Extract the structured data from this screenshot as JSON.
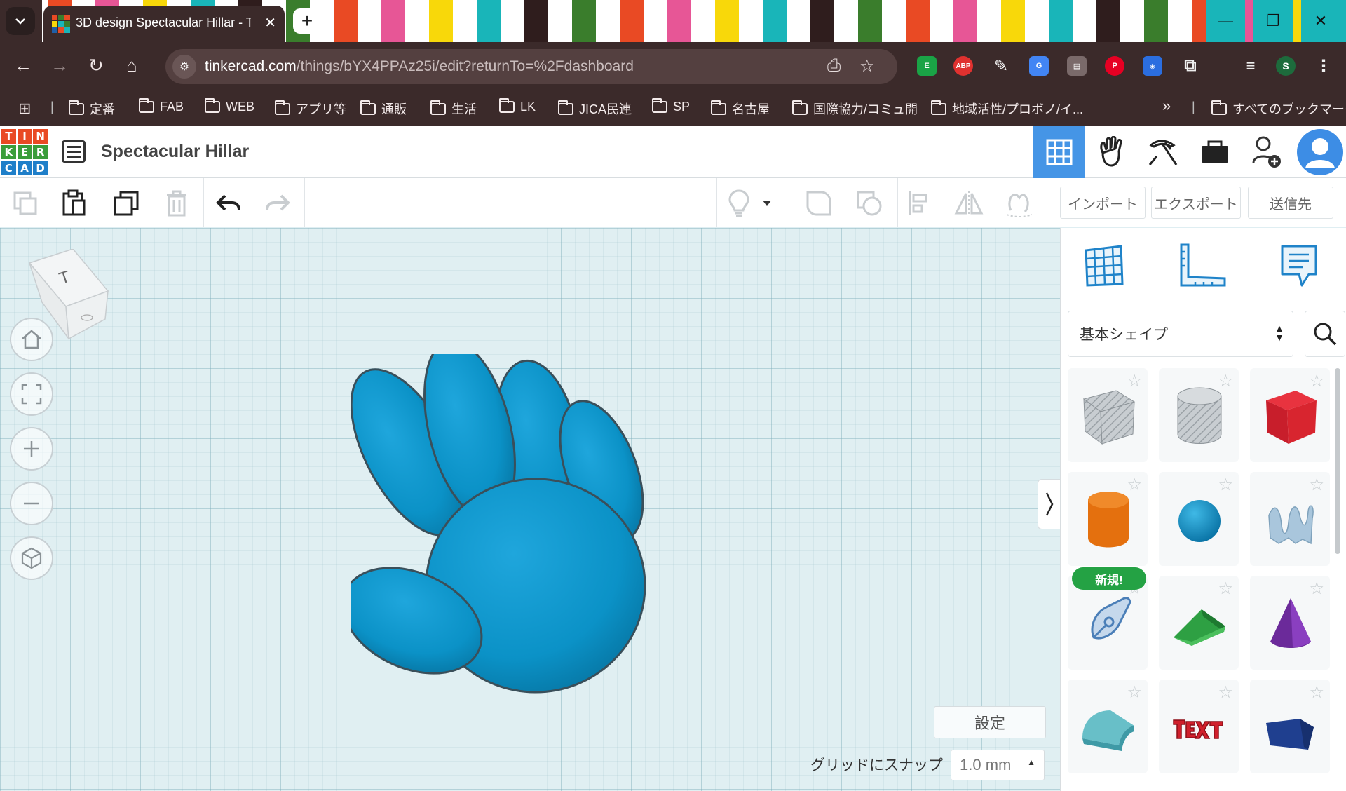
{
  "browser": {
    "tab_title": "3D design Spectacular Hillar - T",
    "url_domain": "tinkercad.com",
    "url_path": "/things/bYX4PPAz25i/edit?returnTo=%2Fdashboard",
    "profile_initial": "S",
    "abp_label": "ABP",
    "bookmarks": [
      "定番",
      "FAB",
      "WEB",
      "アプリ等",
      "通販",
      "生活",
      "LK",
      "JICA民連",
      "SP",
      "名古屋",
      "国際協力/コミュ開",
      "地域活性/プロボノ/イ..."
    ],
    "bookmarks_overflow": "»",
    "all_bookmarks": "すべてのブックマーク"
  },
  "app": {
    "logo_letters": [
      "T",
      "I",
      "N",
      "K",
      "E",
      "R",
      "C",
      "A",
      "D"
    ],
    "design_title": "Spectacular Hillar"
  },
  "toolbar": {
    "import_label": "インポート",
    "export_label": "エクスポート",
    "send_label": "送信先"
  },
  "panel": {
    "category": "基本シェイプ",
    "new_badge": "新規!",
    "shapes": [
      "box-hole",
      "cylinder-hole",
      "box",
      "cylinder",
      "sphere",
      "scribble",
      "shape-generator-new",
      "roof",
      "cone",
      "round-roof",
      "text",
      "polygon"
    ]
  },
  "workplane": {
    "viewcube_label": "T",
    "settings_label": "設定",
    "snap_label": "グリッドにスナップ",
    "snap_value": "1.0 mm"
  },
  "colors": {
    "chrome": "#3b2a2a",
    "paw": "#0b92c7",
    "active_header": "#4595e6",
    "badge": "#24a244"
  }
}
